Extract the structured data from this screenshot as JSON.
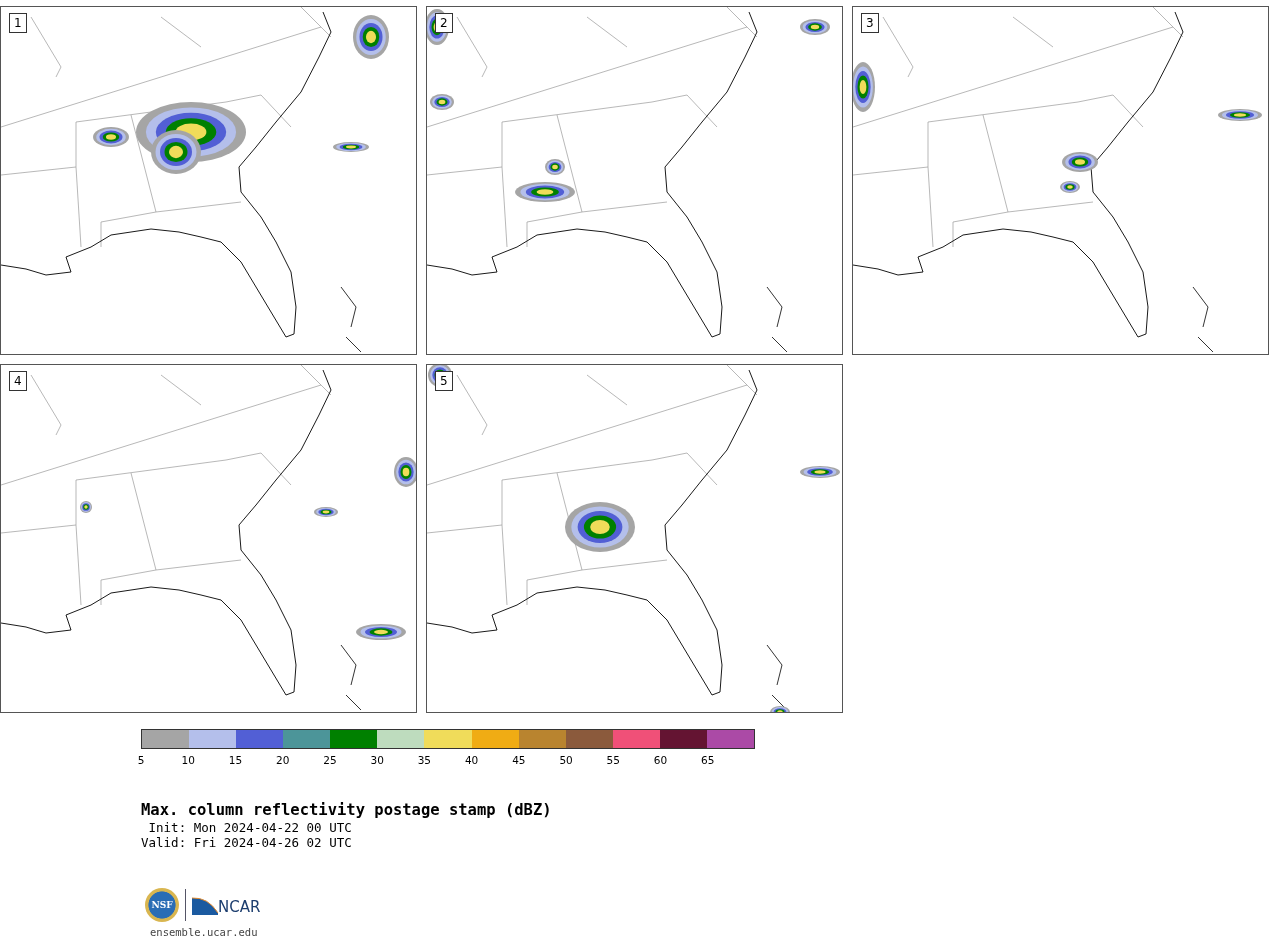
{
  "panels": [
    {
      "number": "1"
    },
    {
      "number": "2"
    },
    {
      "number": "3"
    },
    {
      "number": "4"
    },
    {
      "number": "5"
    }
  ],
  "colorbar": {
    "bins": [
      {
        "color": "#a5a5a5"
      },
      {
        "color": "#b4bfeb"
      },
      {
        "color": "#525fd5"
      },
      {
        "color": "#4c9599"
      },
      {
        "color": "#008000"
      },
      {
        "color": "#bedcbe"
      },
      {
        "color": "#f0dc5a"
      },
      {
        "color": "#f0ac14"
      },
      {
        "color": "#b9842f"
      },
      {
        "color": "#8b5a3c"
      },
      {
        "color": "#f05078"
      },
      {
        "color": "#641432"
      },
      {
        "color": "#ab4aa6"
      }
    ],
    "ticks": [
      "5",
      "10",
      "15",
      "20",
      "25",
      "30",
      "35",
      "40",
      "45",
      "50",
      "55",
      "60",
      "65"
    ]
  },
  "caption": {
    "title": "Max. column reflectivity postage stamp (dBZ)",
    "init": " Init: Mon 2024-04-22 00 UTC",
    "valid": "Valid: Fri 2024-04-26 02 UTC"
  },
  "footer": {
    "nsf_logo_text": "NSF",
    "ncar_logo_text": "NCAR",
    "url": "ensemble.ucar.edu"
  }
}
